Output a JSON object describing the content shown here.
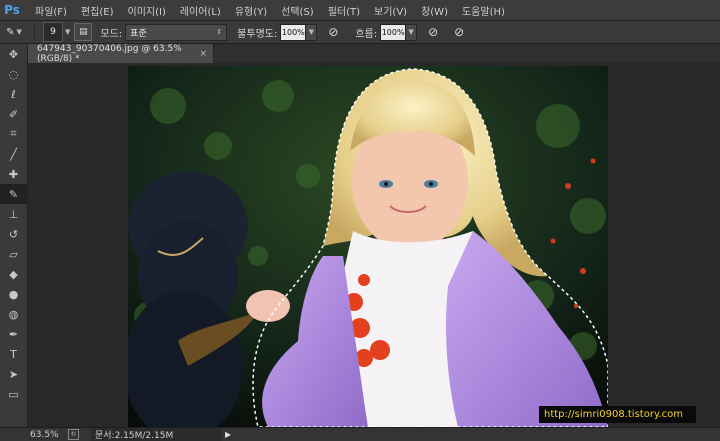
{
  "app": {
    "logo": "Ps"
  },
  "menu": [
    "파일(F)",
    "편집(E)",
    "이미지(I)",
    "레이어(L)",
    "유형(Y)",
    "선택(S)",
    "필터(T)",
    "보기(V)",
    "창(W)",
    "도움말(H)"
  ],
  "options": {
    "brush_size": "9",
    "mode_label": "모드:",
    "mode_value": "표준",
    "opacity_label": "불투명도:",
    "opacity_value": "100%",
    "flow_label": "흐름:",
    "flow_value": "100%"
  },
  "tools": [
    "move-tool",
    "marquee-tool",
    "lasso-tool",
    "quick-selection-tool",
    "crop-tool",
    "eyedropper-tool",
    "healing-brush-tool",
    "brush-tool",
    "clone-stamp-tool",
    "history-brush-tool",
    "eraser-tool",
    "paint-bucket-tool",
    "blur-tool",
    "dodge-tool",
    "pen-tool",
    "type-tool",
    "path-selection-tool",
    "rectangle-tool"
  ],
  "document": {
    "tab_title": "647943_90370406.jpg @ 63.5% (RGB/8) *",
    "close": "×"
  },
  "watermark": "http://simri0908.tistory.com",
  "status": {
    "zoom": "63.5%",
    "info": "문서:2.15M/2.15M",
    "arrow": "▶"
  }
}
